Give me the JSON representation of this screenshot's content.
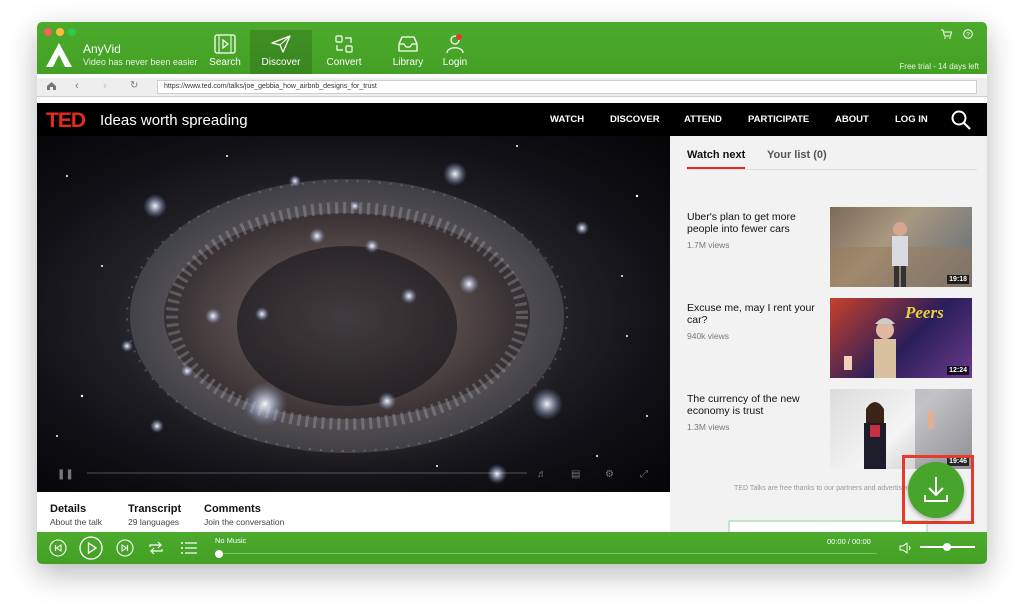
{
  "app": {
    "name": "AnyVid",
    "tagline": "Video has never been easier",
    "free_trial": "Free trial - 14 days left"
  },
  "nav": {
    "search": "Search",
    "discover": "Discover",
    "convert": "Convert",
    "library": "Library",
    "login": "Login",
    "active": "Discover"
  },
  "browser": {
    "url": "https://www.ted.com/talks/joe_gebbia_how_airbnb_designs_for_trust"
  },
  "ted": {
    "logo": "TED",
    "tagline": "Ideas worth spreading",
    "menu": [
      "WATCH",
      "DISCOVER",
      "ATTEND",
      "PARTICIPATE",
      "ABOUT",
      "LOG IN"
    ]
  },
  "details_tabs": [
    {
      "title": "Details",
      "sub": "About the talk"
    },
    {
      "title": "Transcript",
      "sub": "29 languages"
    },
    {
      "title": "Comments",
      "sub": "Join the conversation"
    }
  ],
  "sidebar": {
    "tab_watch_next": "Watch next",
    "tab_your_list": "Your list (0)",
    "talks": [
      {
        "title": "Uber's plan to get more people into fewer cars",
        "views": "1.7M views",
        "duration": "19:18"
      },
      {
        "title": "Excuse me, may I rent your car?",
        "views": "940k views",
        "duration": "12:24"
      },
      {
        "title": "The currency of the new economy is trust",
        "views": "1.3M views",
        "duration": "19:46"
      }
    ],
    "partners_text": "TED Talks are free thanks to our partners and advertisers",
    "thumb2_overlay": "Peers"
  },
  "player": {
    "track": "No Music",
    "time": "00:00 / 00:00",
    "progress": 0,
    "volume": 0.45
  },
  "colors": {
    "brand_green": "#46a52a",
    "ted_red": "#e62b1e",
    "highlight_red": "#e63a2a"
  }
}
